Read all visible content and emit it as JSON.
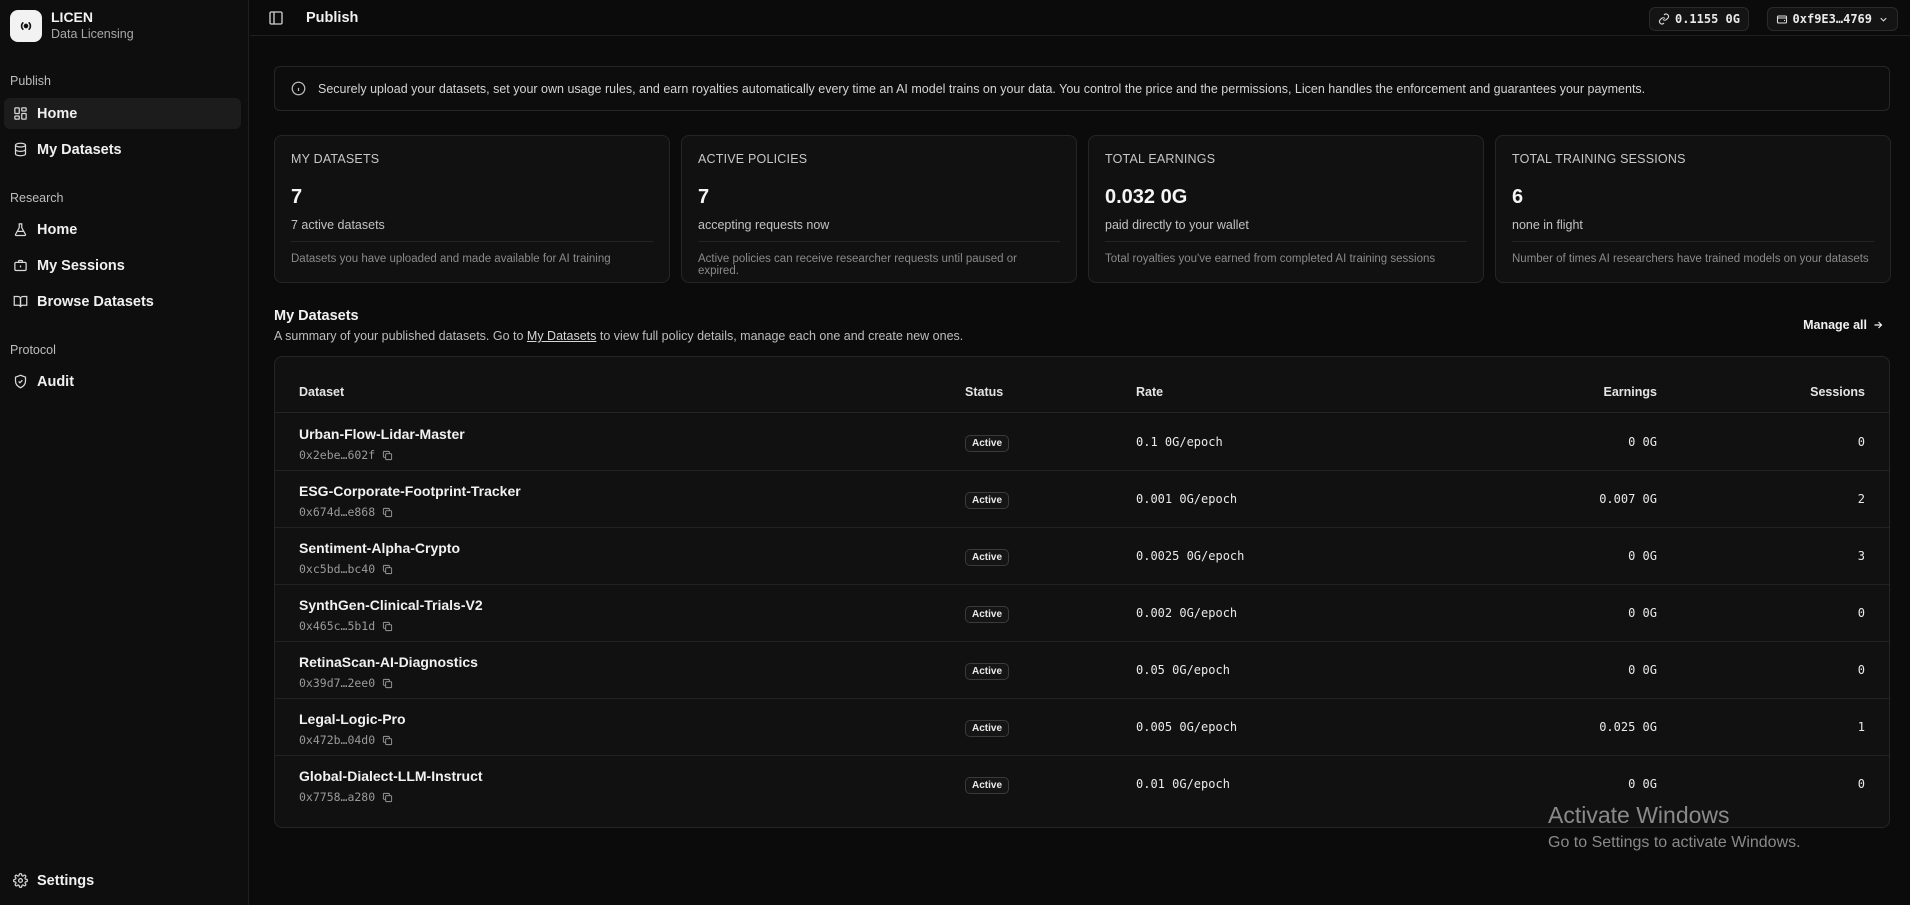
{
  "brand": {
    "name": "LICEN",
    "subtitle": "Data Licensing"
  },
  "sidebar": {
    "sections": [
      {
        "label": "Publish",
        "items": [
          {
            "label": "Home",
            "icon": "grid-icon"
          },
          {
            "label": "My Datasets",
            "icon": "database-icon"
          }
        ]
      },
      {
        "label": "Research",
        "items": [
          {
            "label": "Home",
            "icon": "flask-icon"
          },
          {
            "label": "My Sessions",
            "icon": "briefcase-icon"
          },
          {
            "label": "Browse Datasets",
            "icon": "book-icon"
          }
        ]
      },
      {
        "label": "Protocol",
        "items": [
          {
            "label": "Audit",
            "icon": "shield-check-icon"
          }
        ]
      }
    ],
    "settings_label": "Settings"
  },
  "topbar": {
    "title": "Publish",
    "balance": "0.1155 0G",
    "wallet": "0xf9E3…4769"
  },
  "info_text": "Securely upload your datasets, set your own usage rules, and earn royalties automatically every time an AI model trains on your data. You control the price and the permissions, Licen handles the enforcement and guarantees your payments.",
  "stats": [
    {
      "label": "MY DATASETS",
      "value": "7",
      "sub": "7 active datasets",
      "foot": "Datasets you have uploaded and made available for AI training"
    },
    {
      "label": "ACTIVE POLICIES",
      "value": "7",
      "sub": "accepting requests now",
      "foot": "Active policies can receive researcher requests until paused or expired."
    },
    {
      "label": "TOTAL EARNINGS",
      "value": "0.032 0G",
      "sub": "paid directly to your wallet",
      "foot": "Total royalties you've earned from completed AI training sessions"
    },
    {
      "label": "TOTAL TRAINING SESSIONS",
      "value": "6",
      "sub": "none in flight",
      "foot": "Number of times AI researchers have trained models on your datasets"
    }
  ],
  "datasets_section": {
    "title": "My Datasets",
    "desc_before": "A summary of your published datasets. Go to ",
    "desc_link": "My Datasets",
    "desc_after": " to view full policy details, manage each one and create new ones.",
    "manage_all": "Manage all"
  },
  "table": {
    "columns": [
      "Dataset",
      "Status",
      "Rate",
      "Earnings",
      "Sessions"
    ],
    "rows": [
      {
        "name": "Urban-Flow-Lidar-Master",
        "addr": "0x2ebe…602f",
        "status": "Active",
        "rate": "0.1 0G/epoch",
        "earnings": "0 0G",
        "sessions": "0"
      },
      {
        "name": "ESG-Corporate-Footprint-Tracker",
        "addr": "0x674d…e868",
        "status": "Active",
        "rate": "0.001 0G/epoch",
        "earnings": "0.007 0G",
        "sessions": "2"
      },
      {
        "name": "Sentiment-Alpha-Crypto",
        "addr": "0xc5bd…bc40",
        "status": "Active",
        "rate": "0.0025 0G/epoch",
        "earnings": "0 0G",
        "sessions": "3"
      },
      {
        "name": "SynthGen-Clinical-Trials-V2",
        "addr": "0x465c…5b1d",
        "status": "Active",
        "rate": "0.002 0G/epoch",
        "earnings": "0 0G",
        "sessions": "0"
      },
      {
        "name": "RetinaScan-AI-Diagnostics",
        "addr": "0x39d7…2ee0",
        "status": "Active",
        "rate": "0.05 0G/epoch",
        "earnings": "0 0G",
        "sessions": "0"
      },
      {
        "name": "Legal-Logic-Pro",
        "addr": "0x472b…04d0",
        "status": "Active",
        "rate": "0.005 0G/epoch",
        "earnings": "0.025 0G",
        "sessions": "1"
      },
      {
        "name": "Global-Dialect-LLM-Instruct",
        "addr": "0x7758…a280",
        "status": "Active",
        "rate": "0.01 0G/epoch",
        "earnings": "0 0G",
        "sessions": "0"
      }
    ]
  },
  "watermark": {
    "title": "Activate Windows",
    "sub": "Go to Settings to activate Windows."
  }
}
